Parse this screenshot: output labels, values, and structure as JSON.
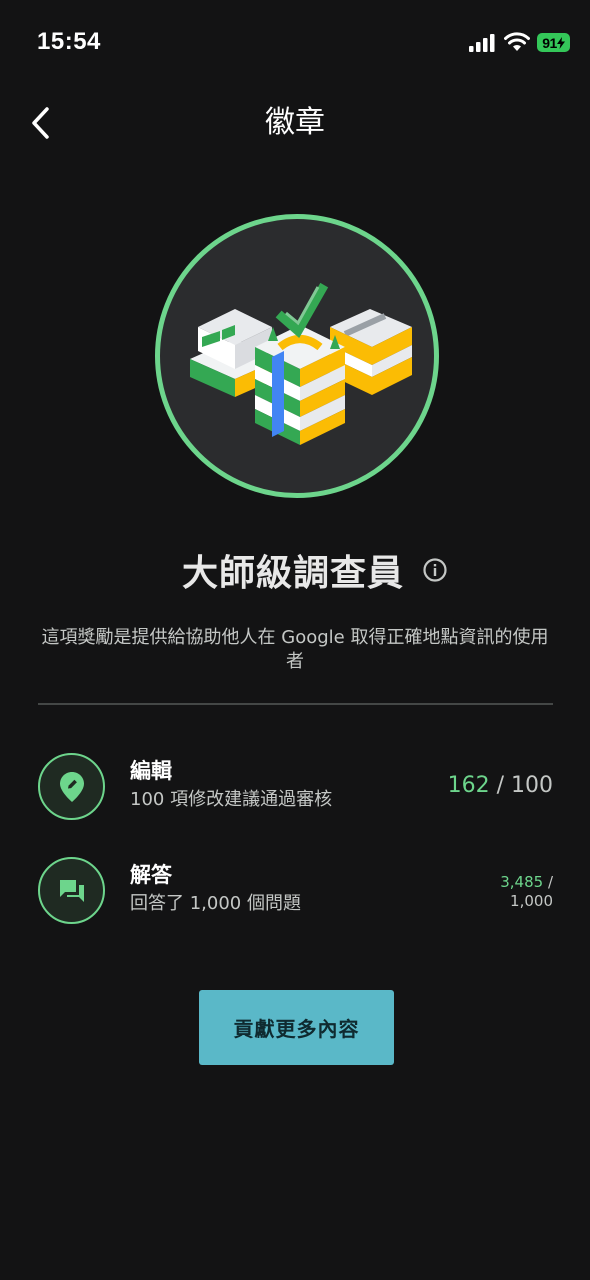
{
  "status_bar": {
    "time": "15:54",
    "battery": "91",
    "icons": [
      "signal-icon",
      "wifi-icon",
      "battery-icon"
    ]
  },
  "header": {
    "title": "徽章",
    "back_icon": "chevron-left-icon"
  },
  "badge": {
    "image": "buildings-checkmark-illustration",
    "title": "大師級調查員",
    "info_icon": "info-icon",
    "description": "這項獎勵是提供給協助他人在 Google 取得正確地點資訊的使用者"
  },
  "requirements": [
    {
      "icon": "edit-pin-icon",
      "title": "編輯",
      "subtitle": "100 項修改建議通過審核",
      "current": "162",
      "separator": " / ",
      "target": "100"
    },
    {
      "icon": "question-answer-icon",
      "title": "解答",
      "subtitle": "回答了 1,000 個問題",
      "current": "3,485",
      "separator": " /",
      "target": "1,000"
    }
  ],
  "cta": {
    "label": "貢獻更多內容"
  },
  "colors": {
    "background": "#131314",
    "accent_green": "#6dd58c",
    "button": "#5ab8c8",
    "battery": "#34c759"
  }
}
